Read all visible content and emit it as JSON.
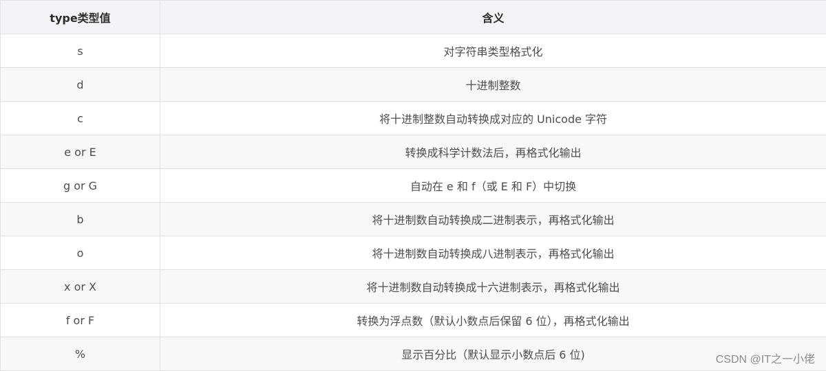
{
  "table": {
    "headers": [
      "type类型值",
      "含义"
    ],
    "rows": [
      {
        "type": "s",
        "meaning": "对字符串类型格式化"
      },
      {
        "type": "d",
        "meaning": "十进制整数"
      },
      {
        "type": "c",
        "meaning": "将十进制整数自动转换成对应的 Unicode 字符"
      },
      {
        "type": "e or E",
        "meaning": "转换成科学计数法后，再格式化输出"
      },
      {
        "type": "g or G",
        "meaning": "自动在 e 和 f（或 E 和 F）中切换"
      },
      {
        "type": "b",
        "meaning": "将十进制数自动转换成二进制表示，再格式化输出"
      },
      {
        "type": "o",
        "meaning": "将十进制数自动转换成八进制表示，再格式化输出"
      },
      {
        "type": "x or X",
        "meaning": "将十进制数自动转换成十六进制表示，再格式化输出"
      },
      {
        "type": "f or F",
        "meaning": "转换为浮点数（默认小数点后保留 6 位），再格式化输出"
      },
      {
        "type": "%",
        "meaning": "显示百分比（默认显示小数点后 6 位)"
      }
    ]
  },
  "watermark": "CSDN @IT之一小佬"
}
